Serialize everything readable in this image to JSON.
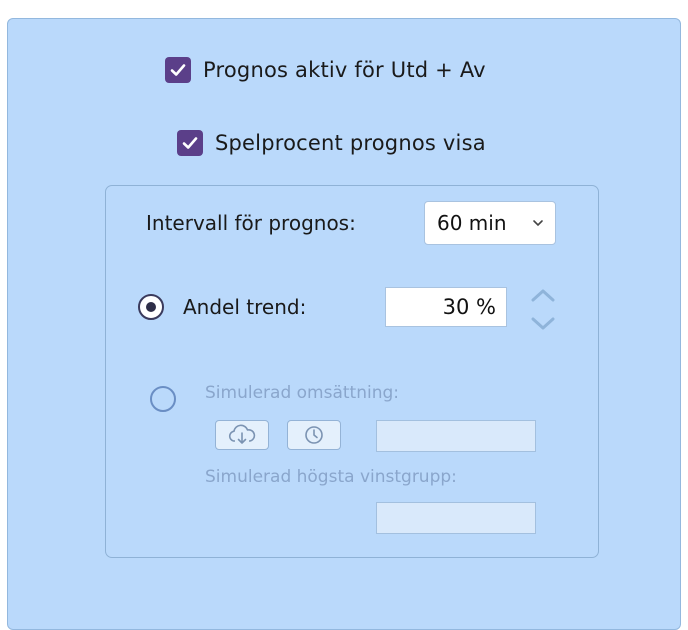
{
  "options": {
    "prognos_active": {
      "label": "Prognos aktiv för Utd + Av",
      "checked": true
    },
    "spelprocent_visa": {
      "label": "Spelprocent prognos visa",
      "checked": true
    }
  },
  "interval": {
    "label": "Intervall för prognos:",
    "selected": "60 min"
  },
  "andel_trend": {
    "label": "Andel trend:",
    "selected": true,
    "value": "30 %"
  },
  "simulerad": {
    "selected": false,
    "omsattning_label": "Simulerad omsättning:",
    "omsattning_value": "",
    "hogsta_label": "Simulerad högsta vinstgrupp:",
    "hogsta_value": ""
  },
  "colors": {
    "panel": "#bad9fb",
    "checkbox": "#5b3f89",
    "disabled_text": "#8aa6cc"
  },
  "icons": [
    "check-icon",
    "chevron-down-icon",
    "spin-up-icon",
    "spin-down-icon",
    "cloud-download-icon",
    "clock-icon"
  ]
}
